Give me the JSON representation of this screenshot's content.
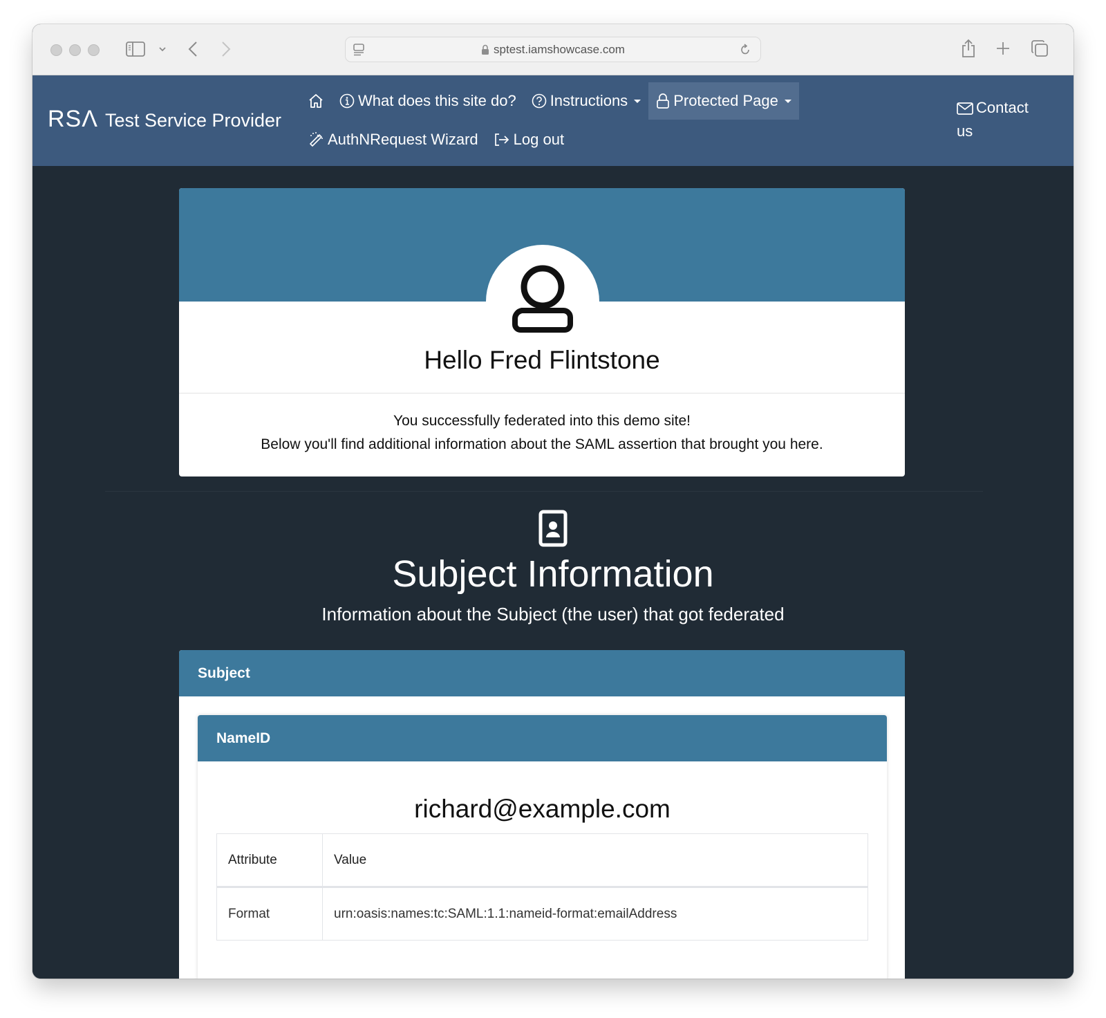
{
  "browser": {
    "url": "sptest.iamshowcase.com",
    "icons": [
      "sidebar-icon",
      "chevron-down-icon",
      "back-icon",
      "forward-icon",
      "reader-icon",
      "lock-icon",
      "reload-icon",
      "share-icon",
      "plus-icon",
      "tabs-icon"
    ]
  },
  "navbar": {
    "brand_logo": "RSΛ",
    "brand_name": "Test Service Provider",
    "items": [
      {
        "label": "",
        "icon": "home-icon"
      },
      {
        "label": "What does this site do?",
        "icon": "info-icon"
      },
      {
        "label": "Instructions",
        "icon": "question-icon",
        "dropdown": true
      },
      {
        "label": "Protected Page",
        "icon": "lock-icon",
        "dropdown": true,
        "active": true
      },
      {
        "label": "AuthNRequest Wizard",
        "icon": "magic-wand-icon"
      },
      {
        "label": "Log out",
        "icon": "logout-icon"
      }
    ],
    "contact": {
      "label": "Contact us",
      "icon": "envelope-icon"
    }
  },
  "hello": {
    "title": "Hello Fred Flintstone",
    "line1": "You successfully federated into this demo site!",
    "line2": "Below you'll find additional information about the SAML assertion that brought you here."
  },
  "subject_section": {
    "title": "Subject Information",
    "subtitle": "Information about the Subject (the user) that got federated"
  },
  "subject_card": {
    "header": "Subject",
    "nameid": {
      "header": "NameID",
      "value": "richard@example.com",
      "table": {
        "columns": [
          "Attribute",
          "Value"
        ],
        "rows": [
          {
            "attribute": "Format",
            "value": "urn:oasis:names:tc:SAML:1.1:nameid-format:emailAddress"
          }
        ]
      }
    }
  },
  "colors": {
    "navbar": "#3d5a7e",
    "navbar_active": "#526d8f",
    "page_bg": "#202b35",
    "card_header": "#3d799c"
  }
}
